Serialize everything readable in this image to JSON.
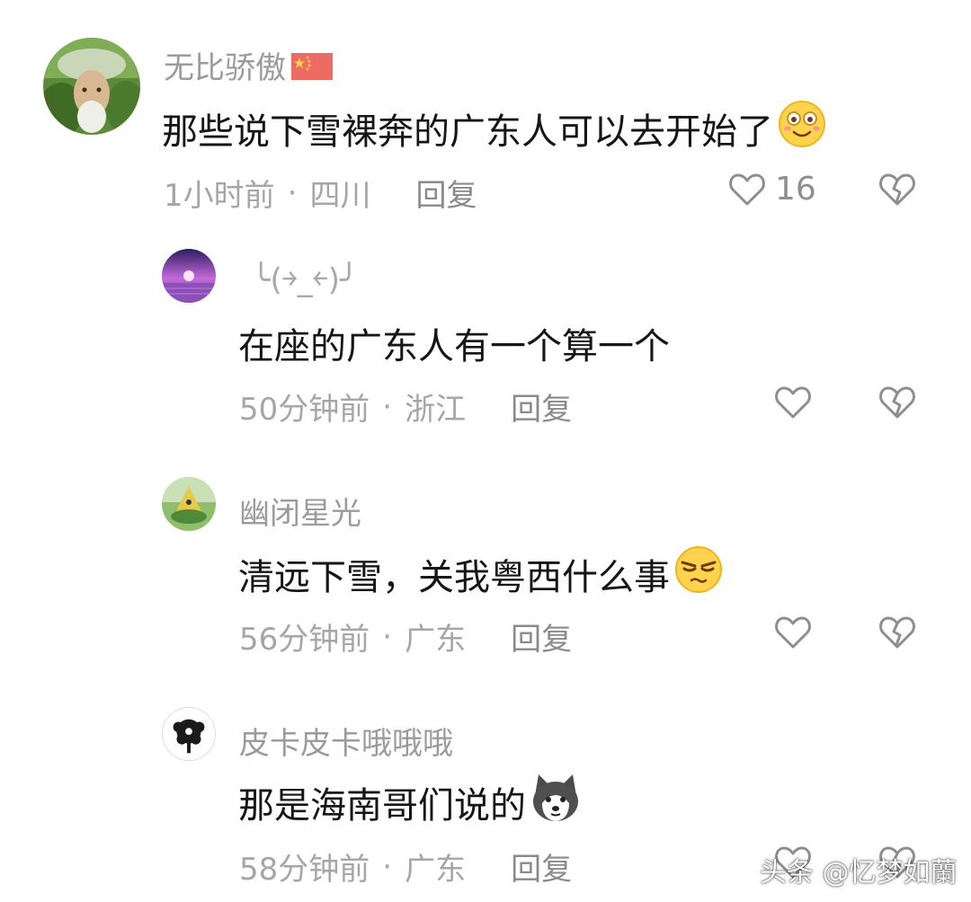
{
  "comments": [
    {
      "username": "无比骄傲",
      "text": "那些说下雪裸奔的广东人可以去开始了",
      "time": "1小时前",
      "location": "四川",
      "reply_label": "回复",
      "likes": "16",
      "emoji": "smile-emoji",
      "flag": "china-flag-icon"
    },
    {
      "username": "╰(￫_￩)╯",
      "text": "在座的广东人有一个算一个",
      "time": "50分钟前",
      "location": "浙江",
      "reply_label": "回复"
    },
    {
      "username": "幽闭星光",
      "text": "清远下雪，关我粤西什么事",
      "time": "56分钟前",
      "location": "广东",
      "reply_label": "回复",
      "emoji": "smug-emoji"
    },
    {
      "username": "皮卡皮卡哦哦哦",
      "text": "那是海南哥们说的",
      "time": "58分钟前",
      "location": "广东",
      "reply_label": "回复",
      "emoji": "husky-dog-emoji"
    }
  ],
  "separator": "·",
  "watermark": "头条 @忆梦如蘭",
  "colors": {
    "username": "#9b9b9b",
    "text": "#161616",
    "meta": "#a6a6a6",
    "icon": "#8e8e8e"
  }
}
